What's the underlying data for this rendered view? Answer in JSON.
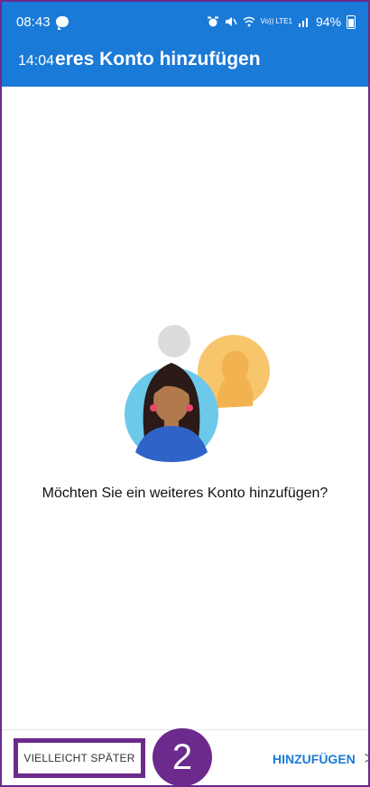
{
  "status": {
    "time": "08:43",
    "battery": "94%",
    "signal": "Vo)) LTE1"
  },
  "appbar": {
    "time_overlay": "14:04",
    "title": "eres Konto hinzufügen"
  },
  "main": {
    "question": "Möchten Sie ein weiteres Konto hinzufügen?"
  },
  "footer": {
    "later_label": "VIELLEICHT SPÄTER",
    "step_badge": "2",
    "add_label": "HINZUFÜGEN",
    "add_chevron": ">"
  },
  "colors": {
    "appbar": "#1a7ad8",
    "accent": "#6b2a8c",
    "link": "#1a7ad8"
  }
}
